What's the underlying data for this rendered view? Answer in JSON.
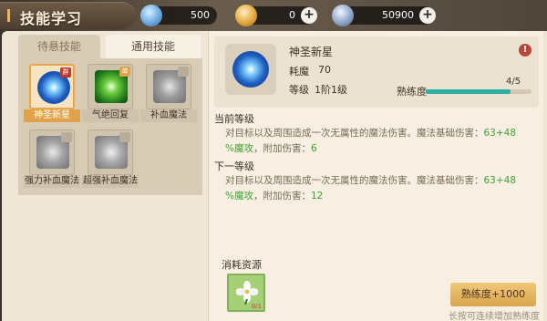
{
  "title": "技能学习",
  "resources": [
    {
      "value": "500",
      "icon": "crystal-icon",
      "color": "#6aa9e0",
      "has_plus": false
    },
    {
      "value": "0",
      "icon": "gold-coin-icon",
      "color": "#e3a73c",
      "has_plus": true
    },
    {
      "value": "50900",
      "icon": "silver-coin-icon",
      "color": "#8ea4c8",
      "has_plus": true
    }
  ],
  "tabs": {
    "active": "待悬技能",
    "inactive": "通用技能"
  },
  "skills": [
    {
      "label": "神圣新星",
      "icon": "holy-nova-icon",
      "badge": "群",
      "selected": true
    },
    {
      "label": "气绝回复",
      "icon": "revive-icon",
      "badge": "单",
      "selected": false
    },
    {
      "label": "补血魔法",
      "icon": "heal-icon",
      "badge": "",
      "selected": false
    },
    {
      "label": "强力补血魔法",
      "icon": "strong-heal-icon",
      "badge": "",
      "selected": false
    },
    {
      "label": "超强补血魔法",
      "icon": "super-heal-icon",
      "badge": "",
      "selected": false
    }
  ],
  "detail": {
    "name": "神圣新星",
    "cost_label": "耗魔",
    "cost_value": "70",
    "level_label": "等级",
    "level_value": "1阶1级",
    "prof_label": "熟练度",
    "prof_value": "4/5",
    "prof_fraction": 0.8
  },
  "current_level": {
    "title": "当前等级",
    "line1_a": "对目标以及周围造成一次无属性的魔法伤害。魔法基础伤害：",
    "line1_b": "63+48",
    "line2_a": "%魔攻",
    "line2_b": "，附加伤害：",
    "line2_c": "6"
  },
  "next_level": {
    "title": "下一等级",
    "line1_a": "对目标以及周围造成一次无属性的魔法伤害。魔法基础伤害：",
    "line1_b": "63+48",
    "line2_a": "%魔攻",
    "line2_b": "，附加伤害：",
    "line2_c": "12"
  },
  "consume": {
    "title": "消耗资源",
    "item_count": "0/1"
  },
  "prof_button": "熟练度+1000",
  "hint": "长按可连续增加熟练度"
}
